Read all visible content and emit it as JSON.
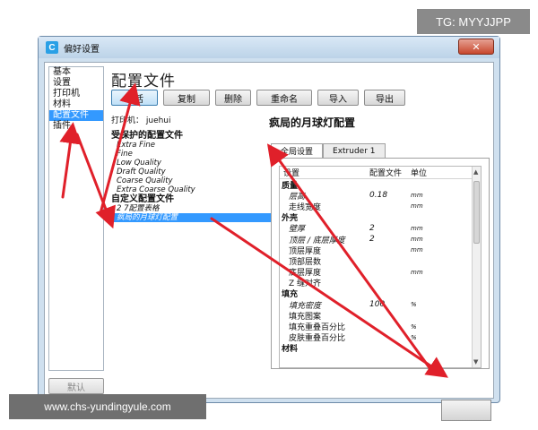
{
  "badge": "TG: MYYJJPP",
  "watermark": "www.chs-yundingyule.com",
  "window": {
    "title": "偏好设置",
    "app_icon": "C",
    "close": "✕"
  },
  "nav": {
    "items": [
      "基本",
      "设置",
      "打印机",
      "材料",
      "配置文件",
      "插件"
    ],
    "selected": 4,
    "reset_button": "默认"
  },
  "main": {
    "heading": "配置文件",
    "toolbar": [
      "激活",
      "复制",
      "删除",
      "重命名",
      "导入",
      "导出"
    ],
    "printer_label": "打印机： juehui",
    "protected_header": "受保护的配置文件",
    "protected_items": [
      "Extra Fine",
      "Fine",
      "Low Quality",
      "Draft Quality",
      "Coarse Quality",
      "Extra Coarse Quality"
    ],
    "custom_header": "自定义配置文件",
    "custom_items": [
      "2 7配置表格",
      "疯局的月球灯配置"
    ],
    "selected_custom": 1,
    "profile_name": "疯局的月球灯配置"
  },
  "settings": {
    "tabs": [
      "全局设置",
      "Extruder 1"
    ],
    "active_tab": 0,
    "columns": [
      "设置",
      "配置文件",
      "单位"
    ],
    "rows": [
      {
        "label": "质量",
        "type": "cat",
        "value": "",
        "unit": ""
      },
      {
        "label": "层高",
        "type": "sub",
        "value": "0.18",
        "unit": "mm"
      },
      {
        "label": "走线宽度",
        "type": "sub",
        "value": "",
        "unit": "mm"
      },
      {
        "label": "外壳",
        "type": "cat",
        "value": "",
        "unit": ""
      },
      {
        "label": "壁厚",
        "type": "sub",
        "value": "2",
        "unit": "mm"
      },
      {
        "label": "顶层 / 底层厚度",
        "type": "sub",
        "value": "2",
        "unit": "mm"
      },
      {
        "label": "顶层厚度",
        "type": "sub",
        "value": "",
        "unit": "mm"
      },
      {
        "label": "顶部层数",
        "type": "sub",
        "value": "",
        "unit": ""
      },
      {
        "label": "底层厚度",
        "type": "sub",
        "value": "",
        "unit": "mm"
      },
      {
        "label": "Z 缝对齐",
        "type": "sub",
        "value": "",
        "unit": ""
      },
      {
        "label": "填充",
        "type": "cat",
        "value": "",
        "unit": ""
      },
      {
        "label": "填充密度",
        "type": "sub",
        "value": "100",
        "unit": "%"
      },
      {
        "label": "填充图案",
        "type": "sub",
        "value": "",
        "unit": ""
      },
      {
        "label": "填充重叠百分比",
        "type": "sub",
        "value": "",
        "unit": "%"
      },
      {
        "label": "皮肤重叠百分比",
        "type": "sub",
        "value": "",
        "unit": "%"
      },
      {
        "label": "材料",
        "type": "cat",
        "value": "",
        "unit": ""
      }
    ]
  },
  "annotation_color": "#e0202a"
}
